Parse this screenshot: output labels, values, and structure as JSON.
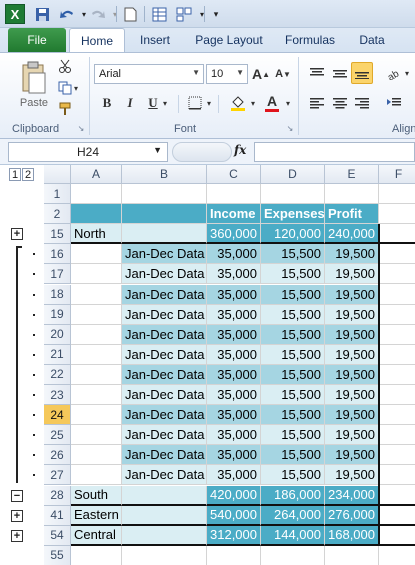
{
  "quick_access": {
    "icons": [
      "excel-logo",
      "save-icon",
      "undo-icon",
      "redo-icon",
      "new-icon",
      "table-icon",
      "layout-icon",
      "customize-icon"
    ]
  },
  "tabs": [
    "File",
    "Home",
    "Insert",
    "Page Layout",
    "Formulas",
    "Data"
  ],
  "ribbon": {
    "clipboard": {
      "paste_label": "Paste",
      "group_label": "Clipboard"
    },
    "font": {
      "font_name": "Arial",
      "font_size": "10",
      "group_label": "Font",
      "bold": "B",
      "italic": "I",
      "underline": "U",
      "grow": "A",
      "shrink": "A",
      "font_color": "A"
    },
    "alignment": {
      "group_label": "Align"
    }
  },
  "formula_bar": {
    "cell_ref": "H24",
    "fx": "fx",
    "formula": ""
  },
  "outline_levels": [
    "1",
    "2"
  ],
  "columns": [
    "A",
    "B",
    "C",
    "D",
    "E",
    "F"
  ],
  "header_row": {
    "row": "2",
    "c": "Income",
    "d": "Expenses",
    "e": "Profit"
  },
  "rows": [
    {
      "row": "1",
      "a": "",
      "b": "",
      "c": "",
      "d": "",
      "e": "",
      "kind": "blank"
    },
    {
      "row": "2",
      "a": "",
      "b": "",
      "c": "Income",
      "d": "Expenses",
      "e": "Profit",
      "kind": "header"
    },
    {
      "row": "15",
      "a": "North",
      "b": "",
      "c": "360,000",
      "d": "120,000",
      "e": "240,000",
      "kind": "summary",
      "outline": "+"
    },
    {
      "row": "16",
      "a": "",
      "b": "Jan-Dec Data",
      "c": "35,000",
      "d": "15,500",
      "e": "19,500",
      "kind": "detail",
      "outline": "."
    },
    {
      "row": "17",
      "a": "",
      "b": "Jan-Dec Data",
      "c": "35,000",
      "d": "15,500",
      "e": "19,500",
      "kind": "detail",
      "outline": "."
    },
    {
      "row": "18",
      "a": "",
      "b": "Jan-Dec Data",
      "c": "35,000",
      "d": "15,500",
      "e": "19,500",
      "kind": "detail",
      "outline": "."
    },
    {
      "row": "19",
      "a": "",
      "b": "Jan-Dec Data",
      "c": "35,000",
      "d": "15,500",
      "e": "19,500",
      "kind": "detail",
      "outline": "."
    },
    {
      "row": "20",
      "a": "",
      "b": "Jan-Dec Data",
      "c": "35,000",
      "d": "15,500",
      "e": "19,500",
      "kind": "detail",
      "outline": "."
    },
    {
      "row": "21",
      "a": "",
      "b": "Jan-Dec Data",
      "c": "35,000",
      "d": "15,500",
      "e": "19,500",
      "kind": "detail",
      "outline": "."
    },
    {
      "row": "22",
      "a": "",
      "b": "Jan-Dec Data",
      "c": "35,000",
      "d": "15,500",
      "e": "19,500",
      "kind": "detail",
      "outline": "."
    },
    {
      "row": "23",
      "a": "",
      "b": "Jan-Dec Data",
      "c": "35,000",
      "d": "15,500",
      "e": "19,500",
      "kind": "detail",
      "outline": "."
    },
    {
      "row": "24",
      "a": "",
      "b": "Jan-Dec Data",
      "c": "35,000",
      "d": "15,500",
      "e": "19,500",
      "kind": "detail",
      "outline": ".",
      "active": true
    },
    {
      "row": "25",
      "a": "",
      "b": "Jan-Dec Data",
      "c": "35,000",
      "d": "15,500",
      "e": "19,500",
      "kind": "detail",
      "outline": "."
    },
    {
      "row": "26",
      "a": "",
      "b": "Jan-Dec Data",
      "c": "35,000",
      "d": "15,500",
      "e": "19,500",
      "kind": "detail",
      "outline": "."
    },
    {
      "row": "27",
      "a": "",
      "b": "Jan-Dec Data",
      "c": "35,000",
      "d": "15,500",
      "e": "19,500",
      "kind": "detail",
      "outline": "."
    },
    {
      "row": "28",
      "a": "South",
      "b": "",
      "c": "420,000",
      "d": "186,000",
      "e": "234,000",
      "kind": "summary2",
      "outline": "-"
    },
    {
      "row": "41",
      "a": "Eastern",
      "b": "",
      "c": "540,000",
      "d": "264,000",
      "e": "276,000",
      "kind": "summary",
      "outline": "+"
    },
    {
      "row": "54",
      "a": "Central",
      "b": "",
      "c": "312,000",
      "d": "144,000",
      "e": "168,000",
      "kind": "summary2",
      "outline": "+"
    },
    {
      "row": "55",
      "a": "",
      "b": "",
      "c": "",
      "d": "",
      "e": "",
      "kind": "blank"
    }
  ],
  "colors": {
    "header_bg": "#4bacc6",
    "summary_light": "#daeef3",
    "summary_dark": "#b7dde8",
    "detail_light": "#daeef3",
    "detail_dark": "#a5d5e2",
    "active_row": "#f5c85a"
  }
}
